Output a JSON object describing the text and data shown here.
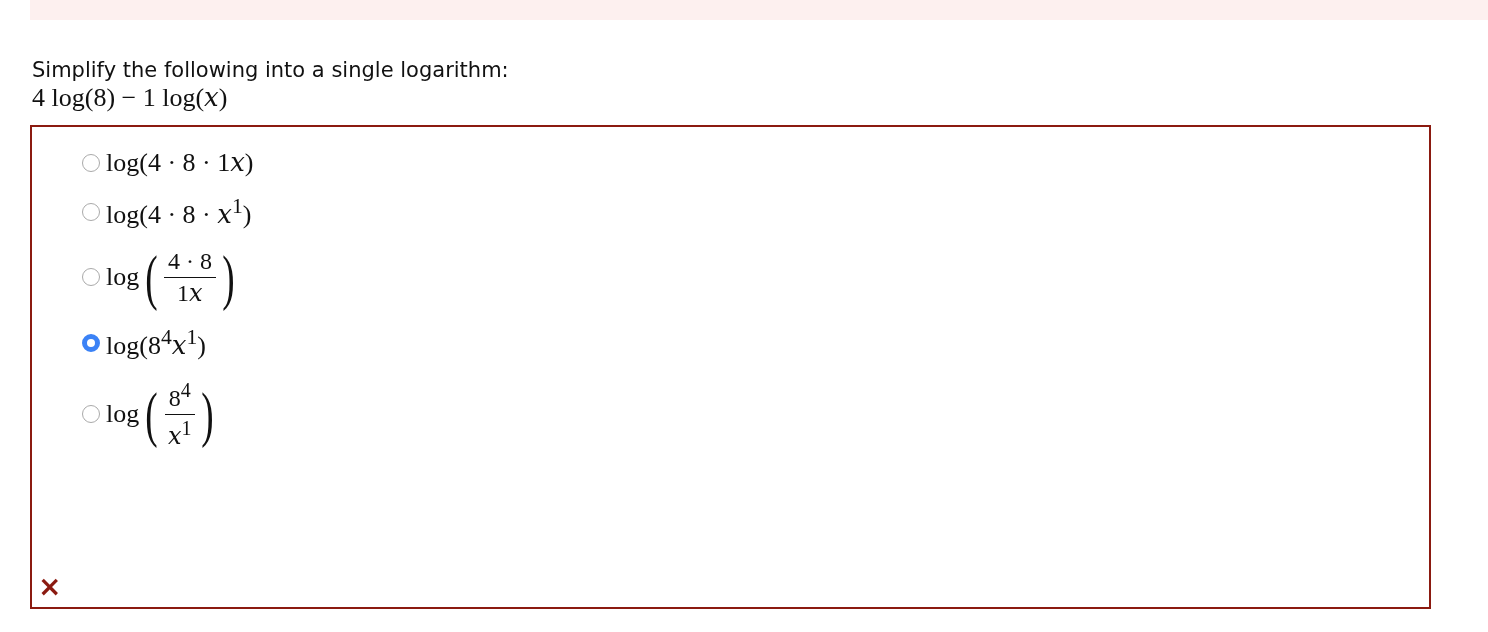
{
  "question": {
    "prompt": "Simplify the following into a single logarithm:",
    "expression": "4 log(8) − 1 log(𝑥)"
  },
  "answer": {
    "result_mark": "×",
    "options": [
      {
        "kind": "inline",
        "text": "log(4 · 8 · 1𝑥)",
        "selected": false
      },
      {
        "kind": "inline",
        "text": "log(4 · 8 · 𝑥$^{1}$)",
        "selected": false
      },
      {
        "kind": "fraction",
        "function": "log",
        "open": "(",
        "numerator": "4 · 8",
        "denominator": "1𝑥",
        "close": ")",
        "selected": false
      },
      {
        "kind": "inline",
        "text": "log(8$^{4}$𝑥$^{1}$)",
        "selected": true
      },
      {
        "kind": "fraction",
        "function": "log",
        "open": "(",
        "numerator": "8$^{4}$",
        "denominator": "𝑥$^{1}$",
        "close": ")",
        "selected": false
      }
    ]
  }
}
